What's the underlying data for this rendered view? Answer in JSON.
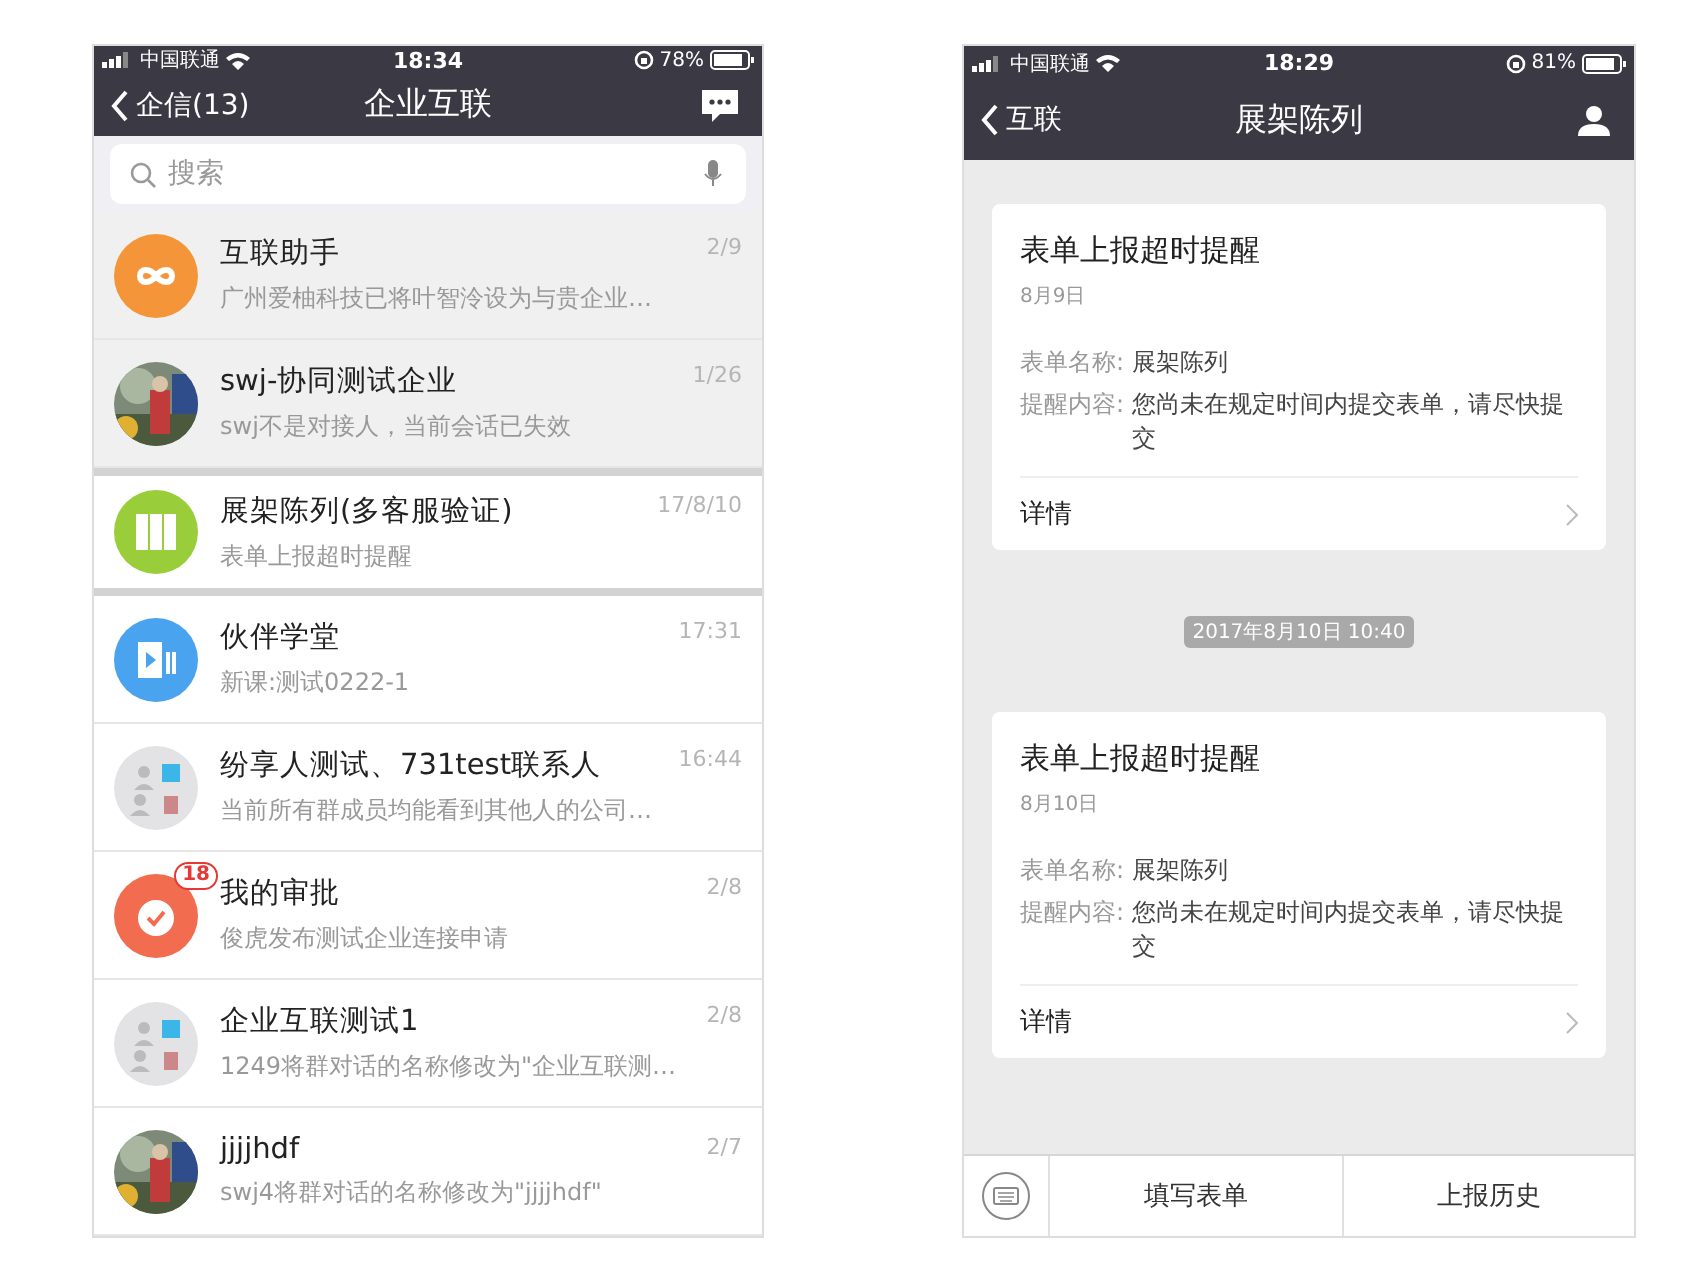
{
  "left_screen": {
    "status_bar": {
      "carrier": "中国联通",
      "time": "18:34",
      "battery": "78%"
    },
    "nav": {
      "back": "企信(13)",
      "title": "企业互联"
    },
    "search": {
      "placeholder": "搜索"
    },
    "chats": [
      {
        "name": "互联助手",
        "preview": "广州爱柚科技已将叶智泠设为与贵企业…",
        "time": "2/9",
        "kind": "infinity",
        "shaded": true,
        "highlighted": false
      },
      {
        "name": "swj-协同测试企业",
        "preview": "swj不是对接人，当前会话已失效",
        "time": "1/26",
        "shaded": true,
        "highlighted": false
      },
      {
        "name": "展架陈列(多客服验证)",
        "preview": "表单上报超时提醒",
        "time": "17/8/10",
        "kind": "shelves",
        "shaded": false,
        "highlighted": true
      },
      {
        "name": "伙伴学堂",
        "preview": "新课:测试0222-1",
        "time": "17:31",
        "kind": "video",
        "shaded": false,
        "highlighted": false
      },
      {
        "name": "纷享人测试、731test联系人",
        "preview": "当前所有群成员均能看到其他人的公司…",
        "time": "16:44",
        "kind": "group",
        "shaded": false,
        "highlighted": false
      },
      {
        "name": "我的审批",
        "preview": "俊虎发布测试企业连接申请",
        "time": "2/8",
        "kind": "approval",
        "badge": "18",
        "shaded": false,
        "highlighted": false
      },
      {
        "name": "企业互联测试1",
        "preview": "1249将群对话的名称修改为\"企业互联测…",
        "time": "2/8",
        "kind": "group",
        "shaded": false,
        "highlighted": false
      },
      {
        "name": "jjjjhdf",
        "preview": "swj4将群对话的名称修改为\"jjjjhdf\"",
        "time": "2/7",
        "shaded": false,
        "highlighted": false
      }
    ]
  },
  "right_screen": {
    "status_bar": {
      "carrier": "中国联通",
      "time": "18:29",
      "battery": "81%"
    },
    "nav": {
      "back": "互联",
      "title": "展架陈列"
    },
    "messages": [
      {
        "kind": "card",
        "title": "表单上报超时提醒",
        "date": "8月9日",
        "fields": [
          {
            "label": "表单名称:",
            "value": "展架陈列"
          },
          {
            "label": "提醒内容:",
            "value": "您尚未在规定时间内提交表单，请尽快提交"
          }
        ],
        "link": "详情"
      },
      {
        "kind": "timestamp",
        "text": "2017年8月10日 10:40"
      },
      {
        "kind": "card",
        "title": "表单上报超时提醒",
        "date": "8月10日",
        "fields": [
          {
            "label": "表单名称:",
            "value": "展架陈列"
          },
          {
            "label": "提醒内容:",
            "value": "您尚未在规定时间内提交表单，请尽快提交"
          }
        ],
        "link": "详情"
      }
    ],
    "bottom_menu": [
      "填写表单",
      "上报历史"
    ]
  }
}
